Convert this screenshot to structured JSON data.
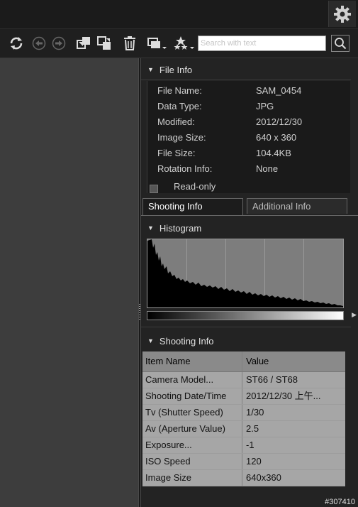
{
  "toolbar": {
    "search_placeholder": "Search with text",
    "icons": [
      "refresh-icon",
      "back-icon",
      "forward-icon",
      "copy-icon",
      "move-icon",
      "trash-icon",
      "stack-icon",
      "rating-icon",
      "search-icon",
      "gear-icon"
    ]
  },
  "file_info": {
    "title": "File Info",
    "rows": [
      {
        "label": "File Name:",
        "value": "SAM_0454"
      },
      {
        "label": "Data Type:",
        "value": "JPG"
      },
      {
        "label": "Modified:",
        "value": "2012/12/30"
      },
      {
        "label": "Image Size:",
        "value": "640 x 360"
      },
      {
        "label": "File Size:",
        "value": "104.4KB"
      },
      {
        "label": "Rotation Info:",
        "value": "None"
      }
    ],
    "readonly_label": "Read-only"
  },
  "tabs": [
    {
      "label": "Shooting Info",
      "active": true
    },
    {
      "label": "Additional Info",
      "active": false
    }
  ],
  "histogram": {
    "title": "Histogram"
  },
  "shooting_info": {
    "title": "Shooting Info",
    "headers": [
      "Item Name",
      "Value"
    ],
    "rows": [
      {
        "name": "Camera Model...",
        "value": "ST66 / ST68"
      },
      {
        "name": "Shooting Date/Time",
        "value": "2012/12/30 上午..."
      },
      {
        "name": "Tv (Shutter Speed)",
        "value": "1/30"
      },
      {
        "name": "Av (Aperture Value)",
        "value": "2.5"
      },
      {
        "name": "Exposure...",
        "value": "-1"
      },
      {
        "name": "ISO Speed",
        "value": "120"
      },
      {
        "name": "Image Size",
        "value": "640x360"
      }
    ]
  },
  "badge": "#307410"
}
